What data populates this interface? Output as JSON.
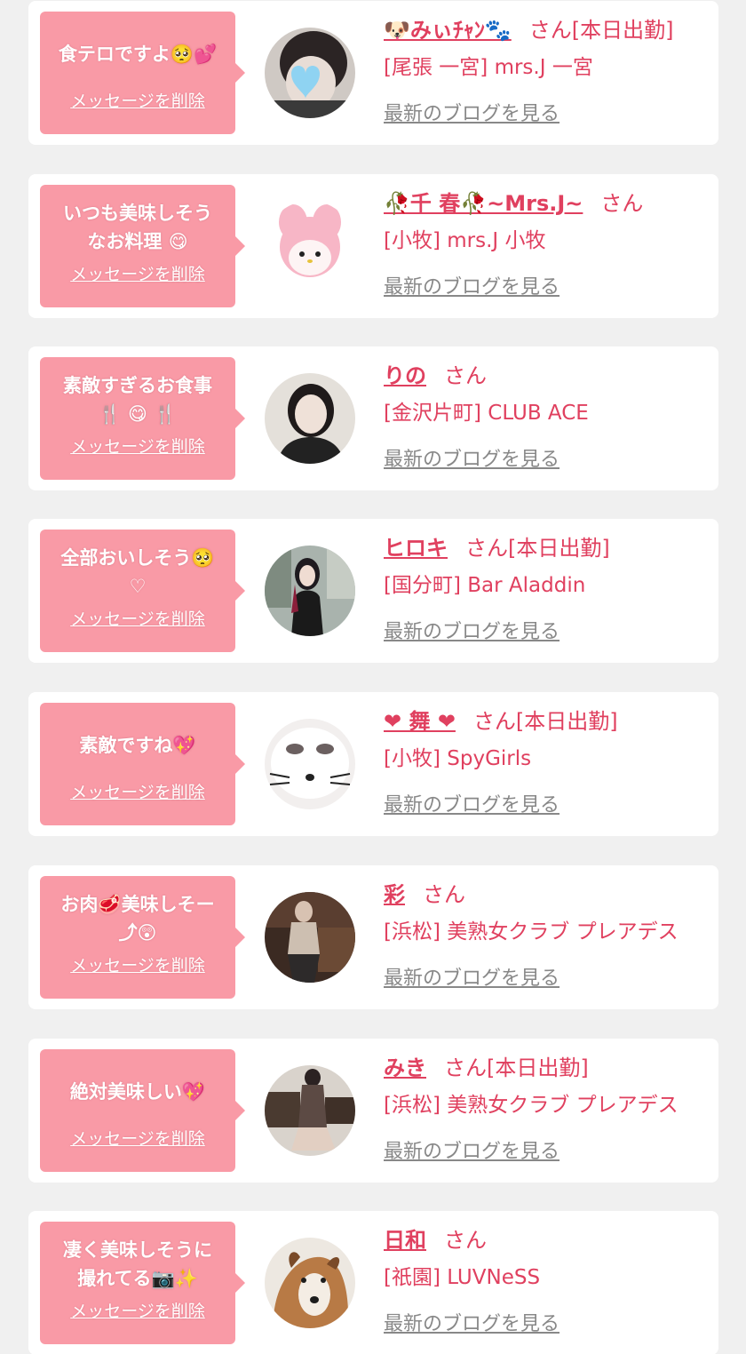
{
  "delete_label": "メッセージを削除",
  "blog_label": "最新のブログを見る",
  "colors": {
    "page_bg": "#f0f0f0",
    "bubble": "#f99aa6",
    "accent": "#e0405f",
    "link_gray": "#888888"
  },
  "items": [
    {
      "message": "食テロですよ🥺💕",
      "name": "🐶みぃﾁｬﾝ🐾",
      "suffix": "さん[本日出勤]",
      "shop": "[尾張 一宮] mrs.J 一宮",
      "avatar_icon": "photo-woman-heart-icon"
    },
    {
      "message": "いつも美味しそう\nなお料理 😋",
      "name": "🥀千 春🥀~Mrs.J~",
      "suffix": "さん",
      "shop": "[小牧] mrs.J 小牧",
      "avatar_icon": "pink-plush-icon"
    },
    {
      "message": "素敵すぎるお食事\n🍴 😋 🍴",
      "name": "りの",
      "suffix": "さん",
      "shop": "[金沢片町] CLUB ACE",
      "avatar_icon": "photo-woman-icon"
    },
    {
      "message": "全部おいしそう🥺\n♡",
      "name": "ヒロキ",
      "suffix": "さん[本日出勤]",
      "shop": "[国分町] Bar Aladdin",
      "avatar_icon": "photo-woman-outdoor-icon"
    },
    {
      "message": "素敵ですね💖",
      "name": "❤ 舞 ❤",
      "suffix": "さん[本日出勤]",
      "shop": "[小牧] SpyGirls",
      "avatar_icon": "photo-cat-face-icon"
    },
    {
      "message": "お肉🥩美味しそー\n⤴😲",
      "name": "彩",
      "suffix": "さん",
      "shop": "[浜松] 美熟女クラブ プレアデス",
      "avatar_icon": "photo-woman-piano-icon"
    },
    {
      "message": "絶対美味しい💖",
      "name": "みき",
      "suffix": "さん[本日出勤]",
      "shop": "[浜松] 美熟女クラブ プレアデス",
      "avatar_icon": "photo-woman-sitting-icon"
    },
    {
      "message": "凄く美味しそうに\n撮れてる📷✨",
      "name": "日和",
      "suffix": "さん",
      "shop": "[祇園] LUVNeSS",
      "avatar_icon": "photo-dog-icon"
    }
  ]
}
